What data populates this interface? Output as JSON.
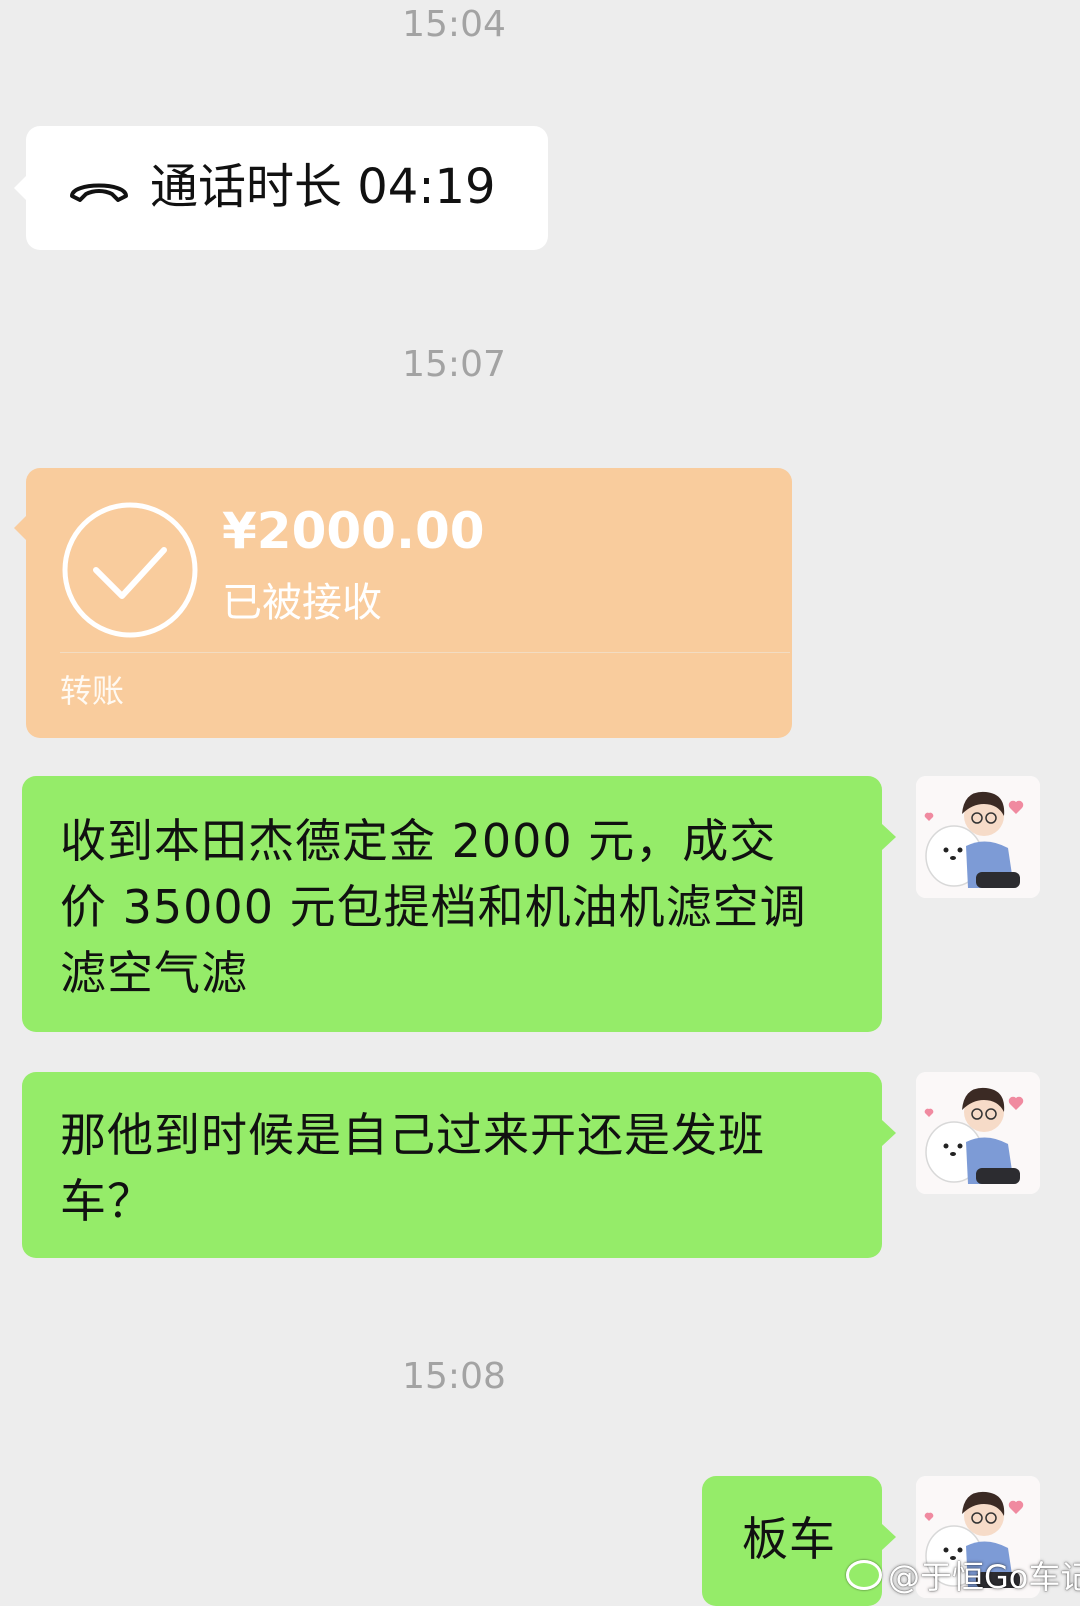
{
  "messages": {
    "time1": "15:04",
    "call": {
      "icon": "phone-hangup-icon",
      "label": "通话时长 04:19"
    },
    "time2": "15:07",
    "transfer": {
      "amount": "¥2000.00",
      "status": "已被接收",
      "label": "转账",
      "icon": "check-circle-icon"
    },
    "msg1": {
      "lines": [
        "收到本田杰德定金 2000 元，成交",
        "价 35000 元包提档和机油机滤空调",
        "滤空气滤"
      ]
    },
    "msg2": {
      "lines": [
        "那他到时候是自己过来开还是发班",
        "车？"
      ]
    },
    "time3": "15:08",
    "msg3": {
      "text": "板车"
    }
  },
  "watermark": {
    "text": "@于恒Go车记",
    "icon": "weibo-logo-icon"
  },
  "colors": {
    "background": "#ededed",
    "incoming_bubble": "#ffffff",
    "transfer_bubble": "#f9cc9d",
    "outgoing_bubble": "#95ec69",
    "timestamp": "#a3a3a3"
  }
}
